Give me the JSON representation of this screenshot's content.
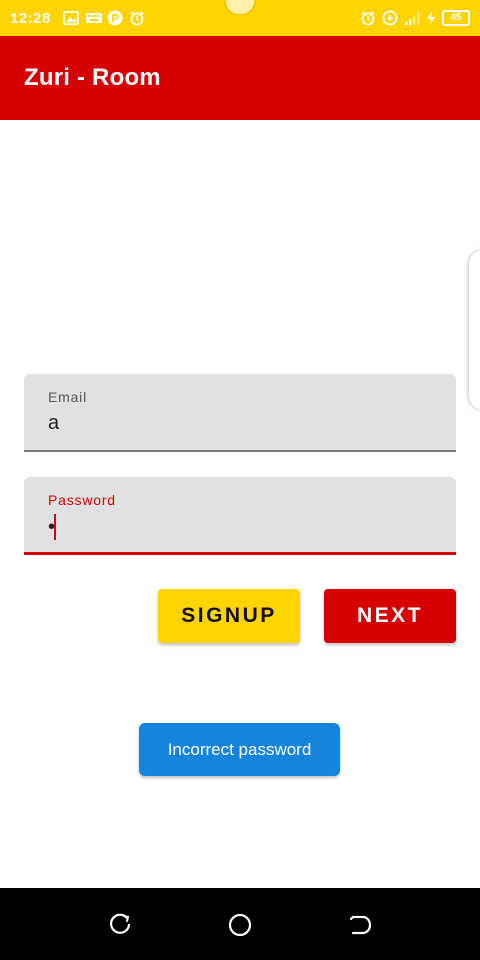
{
  "status_bar": {
    "time": "12:28",
    "battery": "45",
    "left_icons": [
      "image-icon",
      "keyboard-icon",
      "p-icon",
      "alarm-icon"
    ],
    "right_icons": [
      "alarm-icon",
      "plus-circle-icon",
      "signal-icon",
      "charging-icon",
      "battery-icon"
    ],
    "color": "#FFD400"
  },
  "app_bar": {
    "title": "Zuri - Room",
    "color": "#D50000"
  },
  "form": {
    "email": {
      "label": "Email",
      "value": "a"
    },
    "password": {
      "label": "Password",
      "value": "•"
    }
  },
  "buttons": {
    "signup": "SIGNUP",
    "next": "NEXT"
  },
  "toast": {
    "message": "Incorrect password",
    "color": "#1684DA"
  },
  "nav_bar": {
    "icons": [
      "recent-apps-icon",
      "home-icon",
      "back-icon"
    ]
  }
}
